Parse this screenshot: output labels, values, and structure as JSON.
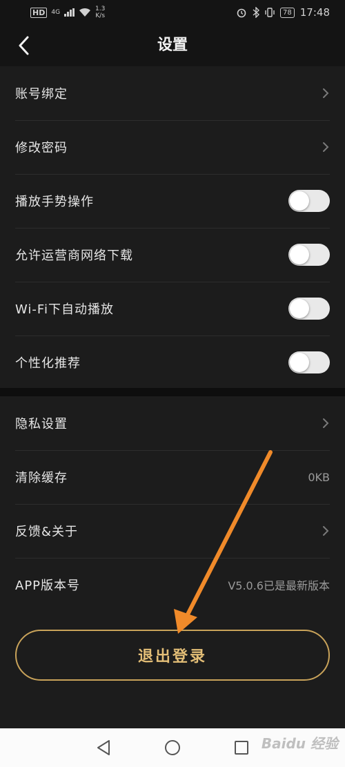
{
  "status_bar": {
    "hd": "HD",
    "net": "4G",
    "speed_value": "1.3",
    "speed_unit": "K/s",
    "battery": "78",
    "time": "17:48"
  },
  "header": {
    "title": "设置"
  },
  "group1": [
    {
      "label": "账号绑定",
      "type": "link"
    },
    {
      "label": "修改密码",
      "type": "link"
    },
    {
      "label": "播放手势操作",
      "type": "toggle",
      "on": false
    },
    {
      "label": "允许运营商网络下载",
      "type": "toggle",
      "on": false
    },
    {
      "label": "Wi-Fi下自动播放",
      "type": "toggle",
      "on": false
    },
    {
      "label": "个性化推荐",
      "type": "toggle",
      "on": false
    }
  ],
  "group2": [
    {
      "label": "隐私设置",
      "type": "link"
    },
    {
      "label": "清除缓存",
      "type": "value",
      "value": "0KB"
    },
    {
      "label": "反馈&关于",
      "type": "link"
    },
    {
      "label": "APP版本号",
      "type": "value",
      "value": "V5.0.6已是最新版本"
    }
  ],
  "logout_label": "退出登录",
  "watermark": "Baidu 经验",
  "colors": {
    "accent_gold": "#e3be77",
    "arrow": "#f08a2a",
    "background": "#1c1c1c"
  }
}
